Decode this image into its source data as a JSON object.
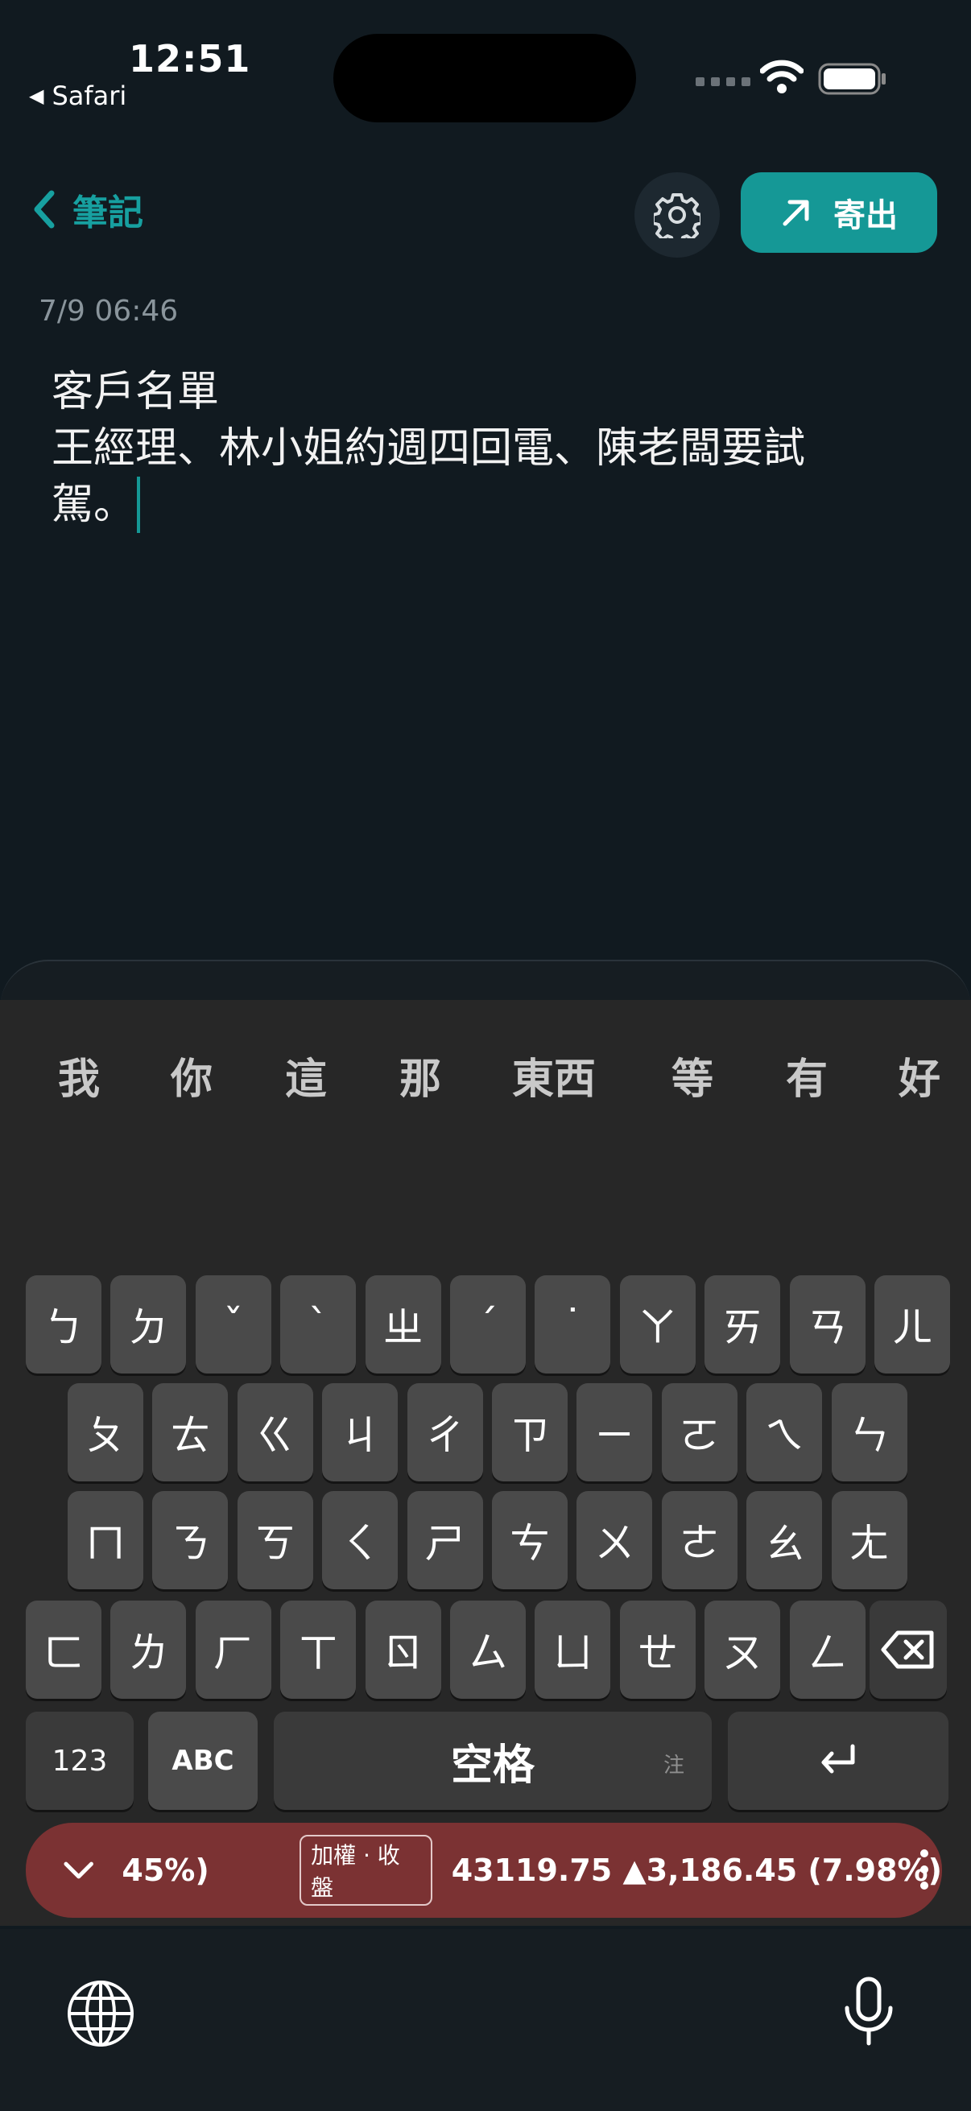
{
  "status_bar": {
    "time": "12:51",
    "back_app": "Safari"
  },
  "nav": {
    "back_label": "筆記",
    "send_label": "寄出"
  },
  "note": {
    "date": "7/9 06:46",
    "lines": [
      "客戶名單",
      "王經理、林小姐約週四回電、陳老闆要試",
      "駕。"
    ]
  },
  "keyboard": {
    "candidates": [
      "我",
      "你",
      "這",
      "那",
      "東西",
      "等",
      "有",
      "好"
    ],
    "row1": [
      "ㄅ",
      "ㄉ",
      "ˇ",
      "ˋ",
      "ㄓ",
      "ˊ",
      "˙",
      "ㄚ",
      "ㄞ",
      "ㄢ",
      "ㄦ"
    ],
    "row2": [
      "ㄆ",
      "ㄊ",
      "ㄍ",
      "ㄐ",
      "ㄔ",
      "ㄗ",
      "ㄧ",
      "ㄛ",
      "ㄟ",
      "ㄣ"
    ],
    "row3": [
      "ㄇ",
      "ㄋ",
      "ㄎ",
      "ㄑ",
      "ㄕ",
      "ㄘ",
      "ㄨ",
      "ㄜ",
      "ㄠ",
      "ㄤ"
    ],
    "row4": [
      "ㄈ",
      "ㄌ",
      "ㄏ",
      "ㄒ",
      "ㄖ",
      "ㄙ",
      "ㄩ",
      "ㄝ",
      "ㄡ",
      "ㄥ"
    ],
    "numbers_key": "123",
    "abc_key": "ABC",
    "space_key": "空格",
    "space_sub": "注"
  },
  "ticker": {
    "percent_text": "45%)",
    "badge": "加權 · 收盤",
    "index_text": "43119.75 ▲3,186.45 (7.98%)"
  },
  "colors": {
    "accent": "#159896",
    "background": "#111a20",
    "ticker": "#7b3233"
  }
}
